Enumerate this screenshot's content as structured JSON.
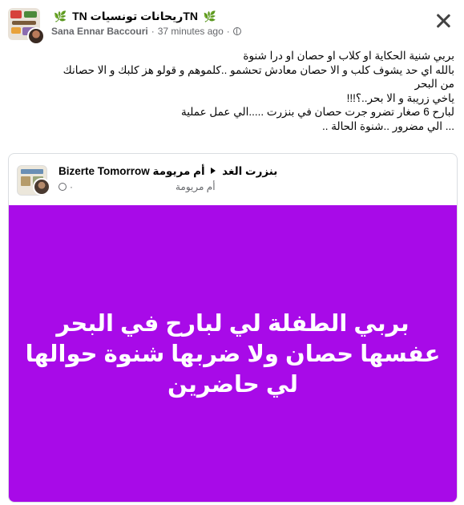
{
  "header": {
    "group_name": "ريحانات تونسياتTN",
    "group_prefix": "TN",
    "leaf_icon_left": "🌿",
    "leaf_icon_right": "🌿",
    "author": "Sana Ennar Baccouri",
    "time": "37 minutes ago"
  },
  "post": {
    "lines": [
      "بربي شنية الحكاية او كلاب او حصان او درا شنوة",
      "بالله اي حد يشوف كلب و الا حصان معادش تحشمو ..كلموهم و قولو هز كلبك و الا حصانك",
      "من البحر",
      "ياخي زريبة و الا بحر..؟!!!",
      "لبارح 6 صغار تضرو جرت حصان  في بنزرت .....الي عمل عملية",
      "... الي مضرور ..شنوة الحالة .."
    ]
  },
  "shared": {
    "page_name": "أم مريومة",
    "target": "Bizerte Tomorrow بنزرت الغد",
    "author": "أم مريومة",
    "sub_dot": "·",
    "headline": "بربي الطفلة لي لبارح في البحر عفسها حصان ولا ضربها شنوة حوالها لي حاضرين",
    "background_color": "#a80ae8"
  }
}
